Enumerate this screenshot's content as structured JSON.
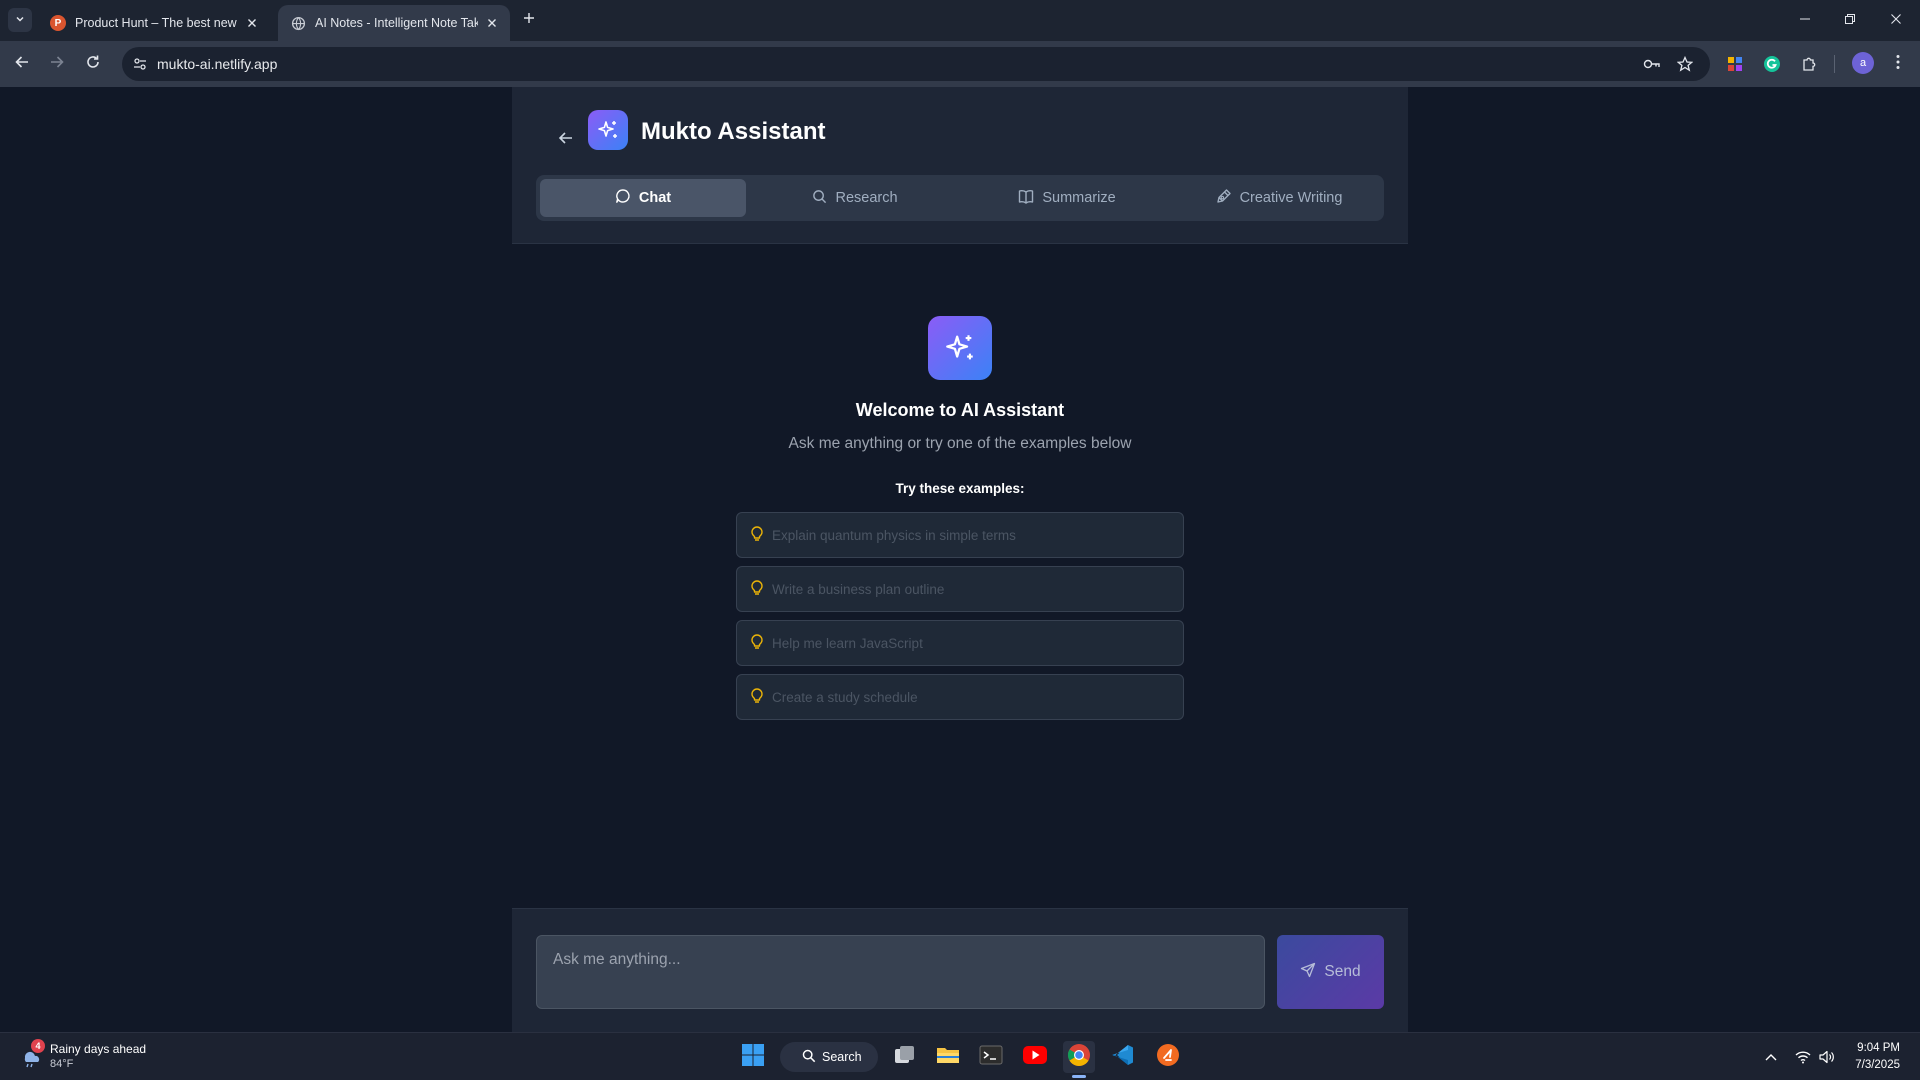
{
  "browser": {
    "tabs": [
      {
        "title": "Product Hunt – The best new p",
        "favicon": "product-hunt-icon",
        "favicon_letter": "P",
        "active": false
      },
      {
        "title": "AI Notes - Intelligent Note Taki",
        "favicon": "globe-icon",
        "active": true
      }
    ],
    "url": "mukto-ai.netlify.app",
    "avatar_letter": "a"
  },
  "app": {
    "title": "Mukto Assistant",
    "modes": [
      {
        "label": "Chat",
        "icon": "chat-bubble-icon",
        "active": true
      },
      {
        "label": "Research",
        "icon": "search-icon",
        "active": false
      },
      {
        "label": "Summarize",
        "icon": "book-icon",
        "active": false
      },
      {
        "label": "Creative Writing",
        "icon": "pen-icon",
        "active": false
      }
    ],
    "welcome": {
      "title": "Welcome to AI Assistant",
      "subtitle": "Ask me anything or try one of the examples below",
      "examples_heading": "Try these examples:",
      "examples": [
        "Explain quantum physics in simple terms",
        "Write a business plan outline",
        "Help me learn JavaScript",
        "Create a study schedule"
      ]
    },
    "composer": {
      "placeholder": "Ask me anything...",
      "send_label": "Send"
    },
    "colors": {
      "accent_gradient_start": "#8b5cf6",
      "accent_gradient_end": "#3b82f6",
      "background": "#111827",
      "hint_icon": "#eab308"
    }
  },
  "taskbar": {
    "weather": {
      "title": "Rainy days ahead",
      "temp": "84°F",
      "badge": "4"
    },
    "search_label": "Search",
    "apps": [
      "start-icon",
      "search-icon",
      "task-view-icon",
      "file-explorer-icon",
      "terminal-icon",
      "youtube-icon",
      "chrome-icon",
      "vscode-icon",
      "app-icon"
    ],
    "clock": {
      "time": "9:04 PM",
      "date": "7/3/2025"
    }
  }
}
